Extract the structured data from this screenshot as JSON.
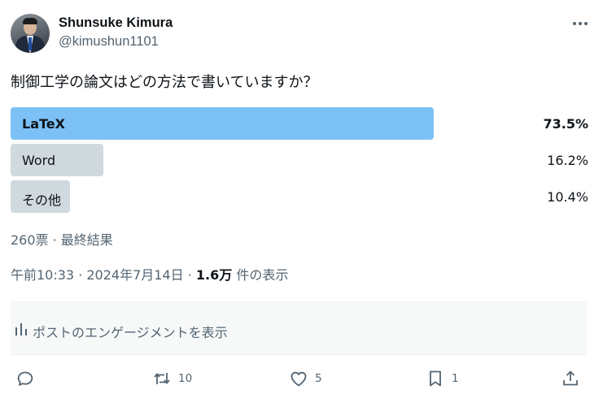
{
  "author": {
    "name": "Shunsuke Kimura",
    "handle": "@kimushun1101"
  },
  "question": "制御工学の論文はどの方法で書いていますか？",
  "poll": {
    "options": [
      {
        "label": "LaTeX",
        "percent_text": "73.5%",
        "percent": 73.5,
        "winner": true
      },
      {
        "label": "Word",
        "percent_text": "16.2%",
        "percent": 16.2,
        "winner": false
      },
      {
        "label": "その他",
        "percent_text": "10.4%",
        "percent": 10.4,
        "winner": false
      }
    ],
    "summary": "260票 · 最終結果"
  },
  "meta": {
    "time": "午前10:33 · 2024年7月14日 · ",
    "views_count": "1.6万",
    "views_label": " 件の表示"
  },
  "engagement_label": "ポストのエンゲージメントを表示",
  "actions": {
    "reply": {
      "icon": "reply-icon",
      "count": ""
    },
    "repost": {
      "icon": "repost-icon",
      "count": "10"
    },
    "like": {
      "icon": "like-icon",
      "count": "5"
    },
    "bookmark": {
      "icon": "bookmark-icon",
      "count": "1"
    },
    "share": {
      "icon": "share-icon",
      "count": ""
    }
  },
  "colors": {
    "winner_bar": "#7cc1f6",
    "other_bar": "#cfd9de",
    "secondary_text": "#536471",
    "primary_text": "#0f1419"
  }
}
